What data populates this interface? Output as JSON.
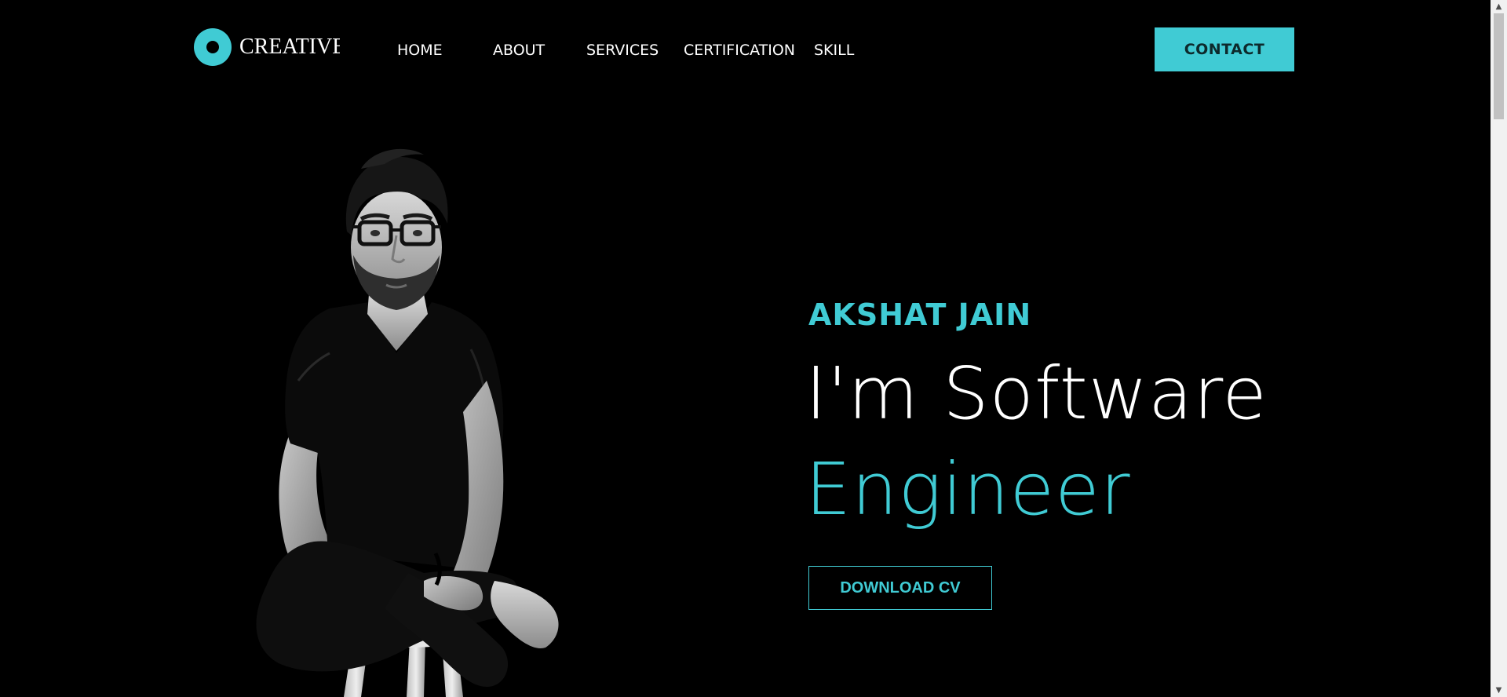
{
  "header": {
    "logo_text": "CREATIVE",
    "nav": [
      {
        "label": "HOME"
      },
      {
        "label": "ABOUT"
      },
      {
        "label": "SERVICES"
      },
      {
        "label": "CERTIFICATION"
      },
      {
        "label": "SKILL"
      }
    ],
    "contact_label": "CONTACT"
  },
  "hero": {
    "name": "AKSHAT JAIN",
    "headline_line1": "I'm Software",
    "headline_line2": "Engineer",
    "download_label": "DOWNLOAD CV",
    "portrait_icon": "person-portrait-photo"
  },
  "colors": {
    "accent": "#40cbd4",
    "background": "#000000",
    "text": "#ffffff"
  },
  "scrollbar": {
    "up_icon": "scroll-up-arrow-icon",
    "down_icon": "scroll-down-arrow-icon"
  }
}
